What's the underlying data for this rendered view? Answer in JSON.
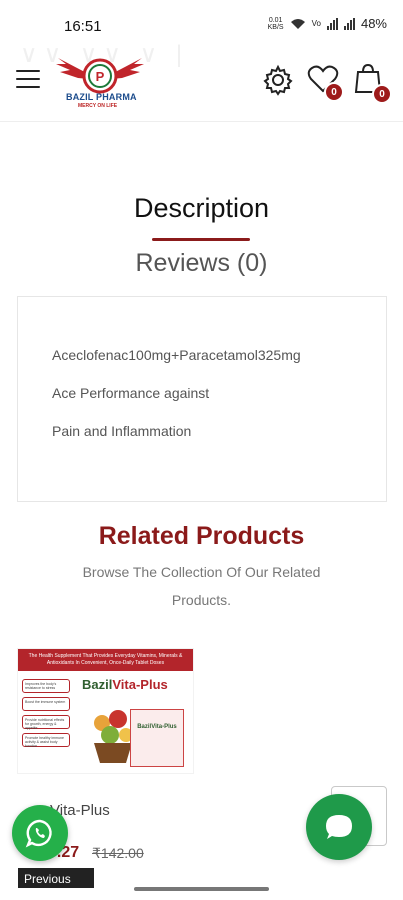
{
  "status_bar": {
    "time": "16:51",
    "speed_value": "0.01",
    "speed_unit": "KB/S",
    "battery": "48%"
  },
  "header": {
    "logo_name": "BAZIL PHARMA",
    "logo_tagline": "MERCY ON LIFE",
    "wishlist_count": "0",
    "cart_count": "0",
    "icons": [
      "menu-icon",
      "settings-gear-icon",
      "heart-icon",
      "shopping-bag-icon"
    ]
  },
  "tabs": {
    "description": "Description",
    "reviews": "Reviews (0)"
  },
  "description": {
    "lines": [
      "Aceclofenac100mg+Paracetamol325mg",
      "Ace Performance against",
      "Pain and Inflammation"
    ]
  },
  "related": {
    "title": "Related Products",
    "subtitle": "Browse The Collection Of Our Related Products."
  },
  "product": {
    "image_banner": "The Health Supplement That Provides Everyday Vitamins, Minerals & Antioxidants In Convenient, Once-Daily Tablet Doses",
    "image_brand_prefix": "Bazil",
    "image_brand_suffix": "Vita-Plus",
    "image_bullets": [
      "Improves the body's resistance to stress",
      "Boost the immune system",
      "Provide nutritional effects for growth, energy & appetite",
      "Promote healthy immune activity & assist body function"
    ],
    "box_label": "BazilVita-Plus",
    "name": "Vita-Plus",
    "price_now": "0.27",
    "price_old": "₹142.00",
    "previous_label": "Previous"
  },
  "colors": {
    "accent": "#8b1a1a",
    "whatsapp": "#25b04a",
    "chat": "#1f9a4a"
  }
}
